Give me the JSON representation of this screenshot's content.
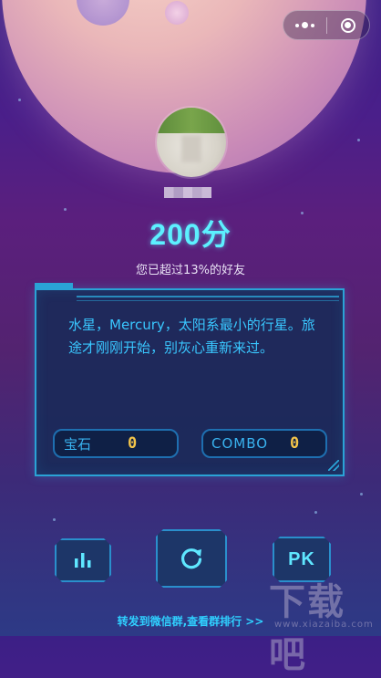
{
  "capsule": {
    "menu_icon": "more-dots-icon",
    "close_icon": "target-close-icon"
  },
  "result": {
    "score_text": "200分",
    "rank_text": "您已超过13%的好友"
  },
  "panel": {
    "message": "水星，Mercury，太阳系最小的行星。旅途才刚刚开始，别灰心重新来过。",
    "gems_label": "宝石",
    "gems_value": "0",
    "combo_label": "COMBO",
    "combo_value": "0"
  },
  "actions": {
    "rank_icon": "bar-chart-icon",
    "replay_icon": "replay-icon",
    "pk_label": "PK"
  },
  "footer": {
    "share_text": "转发到微信群,查看群排行 >>"
  },
  "watermark": {
    "logo": "下载吧",
    "url": "www.xiazaiba.com"
  },
  "colors": {
    "accent": "#5cf0ff",
    "panel_border": "#2aa3d6",
    "value": "#f3c44a"
  }
}
